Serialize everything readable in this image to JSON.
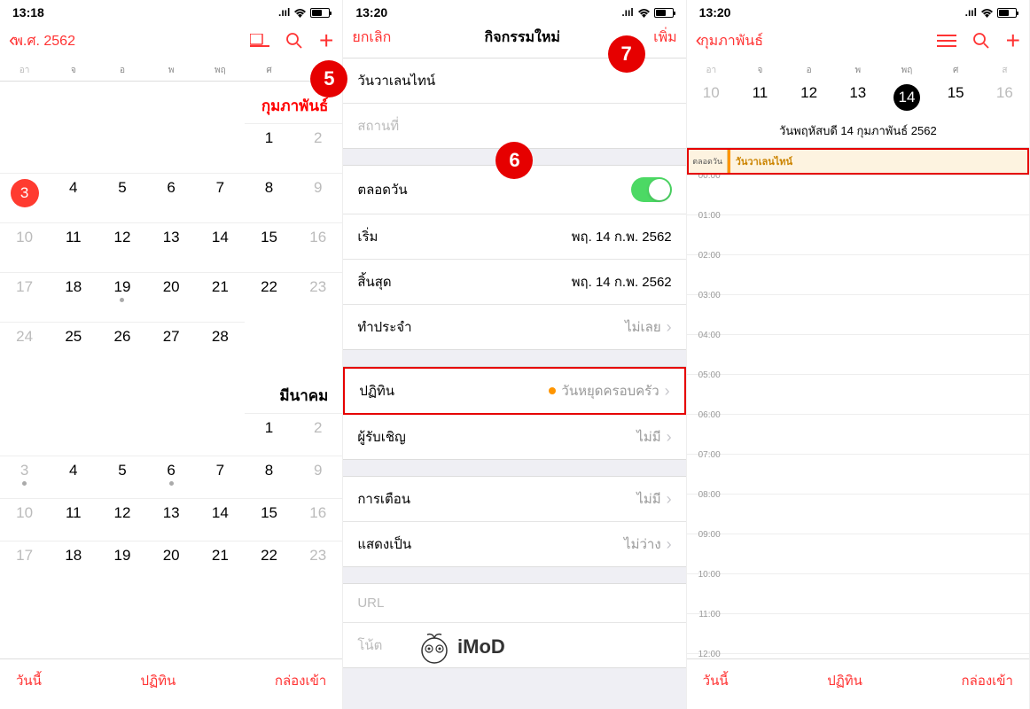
{
  "status": {
    "t1": "13:18",
    "t2": "13:20",
    "t3": "13:20",
    "signal": "▪▪▪▪",
    "wifi": "wifi"
  },
  "p1": {
    "back": "พ.ศ. 2562",
    "wd": [
      "อา",
      "จ",
      "อ",
      "พ",
      "พฤ",
      "ศ",
      "ส"
    ],
    "month1": "กุมภาพันธ์",
    "month2": "มีนาคม",
    "feb": [
      [
        "",
        "",
        "",
        "",
        "",
        "1",
        "2"
      ],
      [
        "3",
        "4",
        "5",
        "6",
        "7",
        "8",
        "9"
      ],
      [
        "10",
        "11",
        "12",
        "13",
        "14",
        "15",
        "16"
      ],
      [
        "17",
        "18",
        "19",
        "20",
        "21",
        "22",
        "23"
      ],
      [
        "24",
        "25",
        "26",
        "27",
        "28",
        "",
        ""
      ]
    ],
    "mar": [
      [
        "",
        "",
        "",
        "",
        "",
        "1",
        "2"
      ],
      [
        "3",
        "4",
        "5",
        "6",
        "7",
        "8",
        "9"
      ],
      [
        "10",
        "11",
        "12",
        "13",
        "14",
        "15",
        "16"
      ],
      [
        "17",
        "18",
        "19",
        "20",
        "21",
        "22",
        "23"
      ]
    ],
    "today": "วันนี้",
    "calendars": "ปฏิทิน",
    "inbox": "กล่องเข้า"
  },
  "p2": {
    "cancel": "ยกเลิก",
    "title": "กิจกรรมใหม่",
    "add": "เพิ่ม",
    "eventTitle": "วันวาเลนไทน์",
    "location": "สถานที่",
    "allday": "ตลอดวัน",
    "start": "เริ่ม",
    "startVal": "พฤ. 14 ก.พ. 2562",
    "end": "สิ้นสุด",
    "endVal": "พฤ. 14 ก.พ. 2562",
    "repeat": "ทำประจำ",
    "repeatVal": "ไม่เลย",
    "calendar": "ปฏิทิน",
    "calendarVal": "วันหยุดครอบครัว",
    "invitees": "ผู้รับเชิญ",
    "inviteesVal": "ไม่มี",
    "alert": "การเตือน",
    "alertVal": "ไม่มี",
    "showAs": "แสดงเป็น",
    "showAsVal": "ไม่ว่าง",
    "url": "URL",
    "notes": "โน้ต"
  },
  "p3": {
    "back": "กุมภาพันธ์",
    "wd": [
      "อา",
      "จ",
      "อ",
      "พ",
      "พฤ",
      "ศ",
      "ส"
    ],
    "nums": [
      "10",
      "11",
      "12",
      "13",
      "14",
      "15",
      "16"
    ],
    "dateLabel": "วันพฤหัสบดี 14 กุมภาพันธ์ 2562",
    "allday": "ตลอดวัน",
    "eventName": "วันวาเลนไทน์",
    "hours": [
      "00:00",
      "01:00",
      "02:00",
      "03:00",
      "04:00",
      "05:00",
      "06:00",
      "07:00",
      "08:00",
      "09:00",
      "10:00",
      "11:00",
      "12:00"
    ],
    "today": "วันนี้",
    "calendars": "ปฏิทิน",
    "inbox": "กล่องเข้า"
  },
  "markers": {
    "m5": "5",
    "m6": "6",
    "m7": "7"
  },
  "watermark": "iMoD"
}
